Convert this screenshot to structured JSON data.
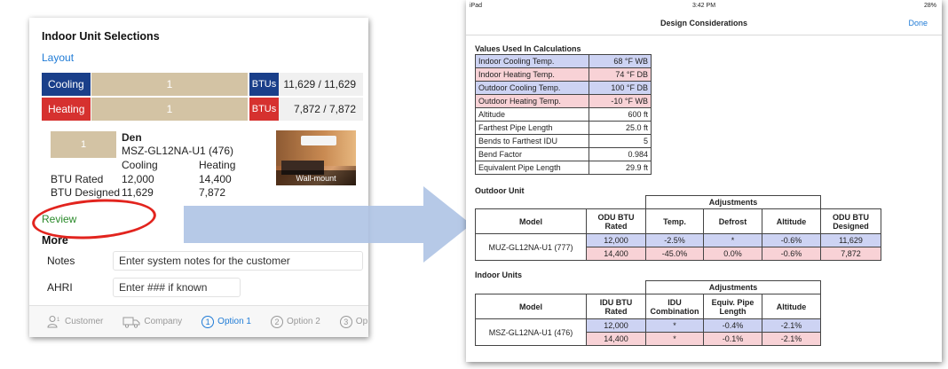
{
  "left": {
    "title": "Indoor Unit Selections",
    "layout_link": "Layout",
    "cooling": {
      "label": "Cooling",
      "bar": "1",
      "unit": "BTUs",
      "value": "11,629 / 11,629"
    },
    "heating": {
      "label": "Heating",
      "bar": "1",
      "unit": "BTUs",
      "value": "7,872 / 7,872"
    },
    "unit": {
      "swatch": "1",
      "room": "Den",
      "model": "MSZ-GL12NA-U1 (476)",
      "photo_caption": "Wall-mount",
      "col_cooling": "Cooling",
      "col_heating": "Heating",
      "rated_label": "BTU Rated",
      "rated_cooling": "12,000",
      "rated_heating": "14,400",
      "designed_label": "BTU Designed",
      "designed_cooling": "11,629",
      "designed_heating": "7,872"
    },
    "review_link": "Review",
    "more_title": "More",
    "notes_label": "Notes",
    "notes_placeholder": "Enter system notes for the customer",
    "ahri_label": "AHRI",
    "ahri_placeholder": "Enter ### if known",
    "tabs": [
      {
        "label": "Customer",
        "icon": "person-icon"
      },
      {
        "label": "Company",
        "icon": "truck-icon"
      },
      {
        "label": "Option 1",
        "num": "1"
      },
      {
        "label": "Option 2",
        "num": "2"
      },
      {
        "label": "Op",
        "num": "3"
      }
    ]
  },
  "right": {
    "status_left": "iPad",
    "status_time": "3:42 PM",
    "status_right": "28%",
    "nav_title": "Design Considerations",
    "nav_done": "Done",
    "values_title": "Values Used In Calculations",
    "values": [
      {
        "label": "Indoor Cooling Temp.",
        "value": "68 °F WB",
        "tone": "blue"
      },
      {
        "label": "Indoor Heating Temp.",
        "value": "74 °F DB",
        "tone": "pink"
      },
      {
        "label": "Outdoor Cooling Temp.",
        "value": "100 °F DB",
        "tone": "blue"
      },
      {
        "label": "Outdoor Heating Temp.",
        "value": "-10 °F WB",
        "tone": "pink"
      },
      {
        "label": "Altitude",
        "value": "600 ft",
        "tone": ""
      },
      {
        "label": "Farthest Pipe Length",
        "value": "25.0 ft",
        "tone": ""
      },
      {
        "label": "Bends to Farthest IDU",
        "value": "5",
        "tone": ""
      },
      {
        "label": "Bend Factor",
        "value": "0.984",
        "tone": ""
      },
      {
        "label": "Equivalent Pipe Length",
        "value": "29.9 ft",
        "tone": ""
      }
    ],
    "outdoor": {
      "title": "Outdoor Unit",
      "adjustments": "Adjustments",
      "headers": {
        "model": "Model",
        "rated": "ODU BTU Rated",
        "temp": "Temp.",
        "defrost": "Defrost",
        "altitude": "Altitude",
        "designed": "ODU BTU Designed"
      },
      "model": "MUZ-GL12NA-U1 (777)",
      "rows": [
        {
          "rated": "12,000",
          "temp": "-2.5%",
          "defrost": "*",
          "altitude": "-0.6%",
          "designed": "11,629"
        },
        {
          "rated": "14,400",
          "temp": "-45.0%",
          "defrost": "0.0%",
          "altitude": "-0.6%",
          "designed": "7,872"
        }
      ]
    },
    "indoor": {
      "title": "Indoor Units",
      "adjustments": "Adjustments",
      "headers": {
        "model": "Model",
        "rated": "IDU BTU Rated",
        "combination": "IDU Combination",
        "pipe": "Equiv. Pipe Length",
        "altitude": "Altitude"
      },
      "model": "MSZ-GL12NA-U1 (476)",
      "rows": [
        {
          "rated": "12,000",
          "combination": "*",
          "pipe": "-0.4%",
          "altitude": "-2.1%"
        },
        {
          "rated": "14,400",
          "combination": "*",
          "pipe": "-0.1%",
          "altitude": "-2.1%"
        }
      ]
    }
  },
  "colors": {
    "cooling": "#1a3f8a",
    "heating": "#d6312f",
    "bar": "#d3c3a4",
    "link": "#1f7bd6",
    "review": "#2a8a2a",
    "highlight": "#e2241e",
    "blue_cell": "#cdd3f3",
    "pink_cell": "#f8d2d6",
    "arrow": "#aec3e4"
  }
}
